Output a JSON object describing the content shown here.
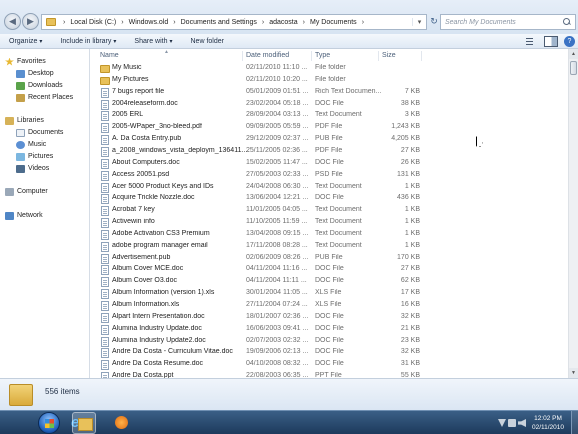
{
  "address": {
    "crumbs": [
      "Local Disk (C:)",
      "Windows.old",
      "Documents and Settings",
      "adacosta",
      "My Documents"
    ],
    "search_placeholder": "Search My Documents"
  },
  "toolbar": {
    "organize": "Organize",
    "include_in_library": "Include in library",
    "share_with": "Share with",
    "new_folder": "New folder"
  },
  "nav": {
    "favorites": "Favorites",
    "desktop": "Desktop",
    "downloads": "Downloads",
    "recent_places": "Recent Places",
    "libraries": "Libraries",
    "documents": "Documents",
    "music": "Music",
    "pictures": "Pictures",
    "videos": "Videos",
    "computer": "Computer",
    "network": "Network"
  },
  "columns": {
    "name": "Name",
    "date_modified": "Date modified",
    "type": "Type",
    "size": "Size"
  },
  "files": [
    {
      "name": "My Music",
      "date": "02/11/2010 11:10 ...",
      "type": "File folder",
      "size": "",
      "icon": "folder"
    },
    {
      "name": "My Pictures",
      "date": "02/11/2010 10:20 ...",
      "type": "File folder",
      "size": "",
      "icon": "folder"
    },
    {
      "name": "7 bugs report file",
      "date": "05/01/2009 01:51 ...",
      "type": "Rich Text Documen...",
      "size": "7 KB",
      "icon": "doc"
    },
    {
      "name": "2004releaseform.doc",
      "date": "23/02/2004 05:18 ...",
      "type": "DOC File",
      "size": "38 KB",
      "icon": "doc"
    },
    {
      "name": "2005 ERL",
      "date": "28/09/2004 03:13 ...",
      "type": "Text Document",
      "size": "3 KB",
      "icon": "doc"
    },
    {
      "name": "2005-WPaper_3no-bleed.pdf",
      "date": "09/09/2005 05:59 ...",
      "type": "PDF File",
      "size": "1,243 KB",
      "icon": "doc"
    },
    {
      "name": "A. Da Costa Entry.pub",
      "date": "29/12/2009 02:37 ...",
      "type": "PUB File",
      "size": "4,205 KB",
      "icon": "doc"
    },
    {
      "name": "a_2008_windows_vista_deploym_136411....",
      "date": "25/11/2005 02:36 ...",
      "type": "PDF File",
      "size": "27 KB",
      "icon": "doc"
    },
    {
      "name": "About Computers.doc",
      "date": "15/02/2005 11:47 ...",
      "type": "DOC File",
      "size": "26 KB",
      "icon": "doc"
    },
    {
      "name": "Access 20051.psd",
      "date": "27/05/2003 02:33 ...",
      "type": "PSD File",
      "size": "131 KB",
      "icon": "doc"
    },
    {
      "name": "Acer 5000 Product Keys and IDs",
      "date": "24/04/2008 06:30 ...",
      "type": "Text Document",
      "size": "1 KB",
      "icon": "doc"
    },
    {
      "name": "Acquire Trickle Nozzle.doc",
      "date": "13/06/2004 12:21 ...",
      "type": "DOC File",
      "size": "436 KB",
      "icon": "doc"
    },
    {
      "name": "Acrobat 7 key",
      "date": "11/01/2005 04:05 ...",
      "type": "Text Document",
      "size": "1 KB",
      "icon": "doc"
    },
    {
      "name": "Activewin info",
      "date": "11/10/2005 11:59 ...",
      "type": "Text Document",
      "size": "1 KB",
      "icon": "doc"
    },
    {
      "name": "Adobe Activation CS3 Premium",
      "date": "13/04/2008 09:15 ...",
      "type": "Text Document",
      "size": "1 KB",
      "icon": "doc"
    },
    {
      "name": "adobe program manager email",
      "date": "17/11/2008 08:28 ...",
      "type": "Text Document",
      "size": "1 KB",
      "icon": "doc"
    },
    {
      "name": "Advertisement.pub",
      "date": "02/06/2009 08:26 ...",
      "type": "PUB File",
      "size": "170 KB",
      "icon": "doc"
    },
    {
      "name": "Album Cover MCE.doc",
      "date": "04/11/2004 11:16 ...",
      "type": "DOC File",
      "size": "27 KB",
      "icon": "doc"
    },
    {
      "name": "Album Cover O3.doc",
      "date": "04/11/2004 11:11 ...",
      "type": "DOC File",
      "size": "62 KB",
      "icon": "doc"
    },
    {
      "name": "Album Information (version 1).xls",
      "date": "30/01/2004 11:05 ...",
      "type": "XLS File",
      "size": "17 KB",
      "icon": "doc"
    },
    {
      "name": "Album Information.xls",
      "date": "27/11/2004 07:24 ...",
      "type": "XLS File",
      "size": "16 KB",
      "icon": "doc"
    },
    {
      "name": "Alpart Intern Presentation.doc",
      "date": "18/01/2007 02:36 ...",
      "type": "DOC File",
      "size": "32 KB",
      "icon": "doc"
    },
    {
      "name": "Alumina Industry Update.doc",
      "date": "16/06/2003 09:41 ...",
      "type": "DOC File",
      "size": "21 KB",
      "icon": "doc"
    },
    {
      "name": "Alumina Industry Update2.doc",
      "date": "02/07/2003 02:32 ...",
      "type": "DOC File",
      "size": "23 KB",
      "icon": "doc"
    },
    {
      "name": "Andre Da Costa - Curriculum Vitae.doc",
      "date": "19/09/2006 02:13 ...",
      "type": "DOC File",
      "size": "32 KB",
      "icon": "doc"
    },
    {
      "name": "Andre Da Costa Resume.doc",
      "date": "04/10/2008 08:32 ...",
      "type": "DOC File",
      "size": "31 KB",
      "icon": "doc"
    },
    {
      "name": "Andre Da Costa.ppt",
      "date": "22/08/2003 06:35 ...",
      "type": "PPT File",
      "size": "55 KB",
      "icon": "doc"
    }
  ],
  "status": {
    "item_count": "556 items"
  },
  "taskbar": {
    "time": "12:02 PM",
    "date": "02/11/2010"
  }
}
